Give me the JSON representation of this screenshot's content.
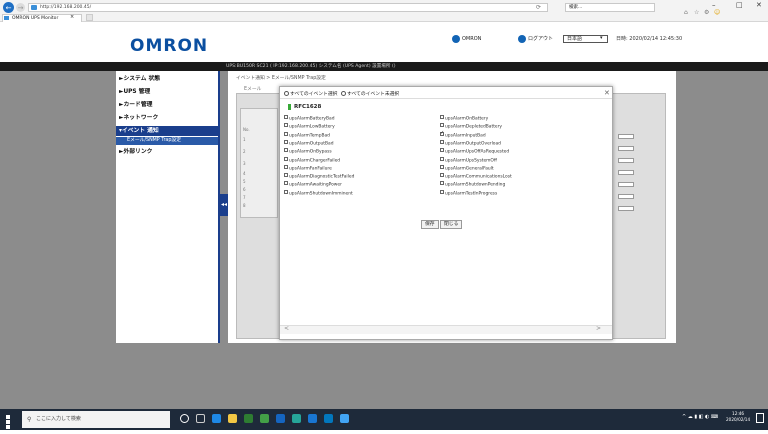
{
  "browser": {
    "url": "http://192.168.200.45/",
    "tab_title": "OMRON UPS Monitor",
    "tab_close": "×",
    "search_placeholder": "検索..."
  },
  "header": {
    "logo": "OMRON",
    "user": "OMRON",
    "logout": "ログアウト",
    "language": "日本語",
    "datetime": "日時: 2020/02/14 12:45:30"
  },
  "status_line": "UPS:BU150R    SC21 ( IP:192.168.200.45)    システム名 (UPS Agent)    設置場所 ()",
  "sidebar": {
    "items": [
      {
        "label": "►システム 状態"
      },
      {
        "label": "►UPS 管理"
      },
      {
        "label": "►カード管理"
      },
      {
        "label": "►ネットワーク"
      },
      {
        "label": "▾イベント 通知"
      },
      {
        "label": "►外部リンク"
      }
    ],
    "subitem": "Eメール/SNMP Trap設定",
    "collapse": "◂◂"
  },
  "content": {
    "breadcrumb": "イベント通知 > Eメール/SNMP Trap設定",
    "bg_label": "Eメール",
    "bg_table_header": "No.",
    "bg_rows": [
      "1",
      "2",
      "3",
      "4",
      "5",
      "6",
      "7",
      "8"
    ]
  },
  "dialog": {
    "select_all": "すべてのイベント選択",
    "deselect_all": "すべてのイベント未選択",
    "close": "✕",
    "section_title": "RFC1628",
    "left_items": [
      {
        "label": "upsAlarmBatteryBad",
        "checked": false
      },
      {
        "label": "upsAlarmLowBattery",
        "checked": false
      },
      {
        "label": "upsAlarmTempBad",
        "checked": false
      },
      {
        "label": "upsAlarmOutputBad",
        "checked": false
      },
      {
        "label": "upsAlarmOnBypass",
        "checked": false
      },
      {
        "label": "upsAlarmChargerFailed",
        "checked": false
      },
      {
        "label": "upsAlarmFanFailure",
        "checked": false
      },
      {
        "label": "upsAlarmDiagnosticTestFailed",
        "checked": false
      },
      {
        "label": "upsAlarmAwaitingPower",
        "checked": false
      },
      {
        "label": "upsAlarmShutdownImminent",
        "checked": false
      }
    ],
    "right_items": [
      {
        "label": "upsAlarmOnBattery",
        "checked": false
      },
      {
        "label": "upsAlarmDepletedBattery",
        "checked": false
      },
      {
        "label": "upsAlarmInputBad",
        "checked": true
      },
      {
        "label": "upsAlarmOutputOverload",
        "checked": false
      },
      {
        "label": "upsAlarmUpsOffAsRequested",
        "checked": false
      },
      {
        "label": "upsAlarmUpsSystemOff",
        "checked": false
      },
      {
        "label": "upsAlarmGeneralFault",
        "checked": false
      },
      {
        "label": "upsAlarmCommunicationsLost",
        "checked": false
      },
      {
        "label": "upsAlarmShutdownPending",
        "checked": false
      },
      {
        "label": "upsAlarmTestInProgress",
        "checked": false
      }
    ],
    "save": "保存",
    "cancel": "閉じる",
    "scroll_left": "<",
    "scroll_right": ">"
  },
  "taskbar": {
    "search": "ここに入力して検索",
    "clock_time": "12:46",
    "clock_date": "2020/02/14"
  },
  "window_controls": {
    "minimize": "–",
    "maximize": "□",
    "close": "✕"
  },
  "colors": {
    "brand": "#0b4fa0",
    "nav_active": "#1a3e8c",
    "accent_green": "#37a937"
  }
}
